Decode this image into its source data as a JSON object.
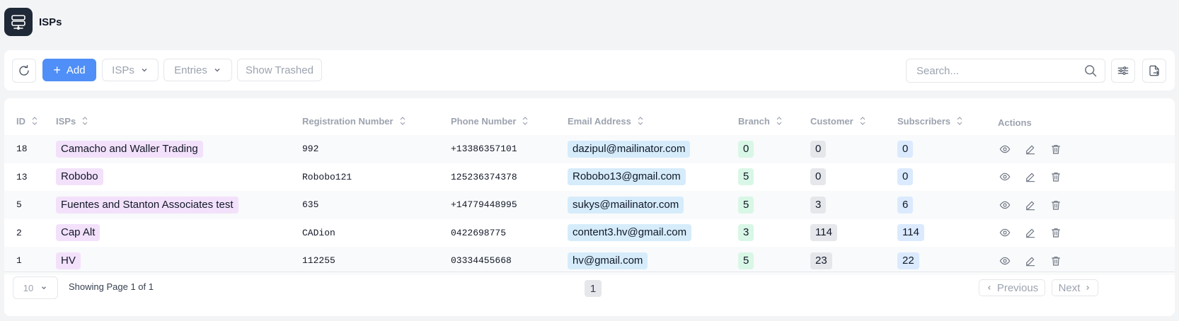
{
  "app": {
    "title": "ISPs"
  },
  "toolbar": {
    "add_label": "Add",
    "isps_dropdown": "ISPs",
    "entries_dropdown": "Entries",
    "show_trashed_label": "Show Trashed",
    "search_placeholder": "Search..."
  },
  "table": {
    "columns": [
      "ID",
      "ISPs",
      "Registration Number",
      "Phone Number",
      "Email Address",
      "Branch",
      "Customer",
      "Subscribers",
      "Actions"
    ],
    "rows": [
      {
        "id": "18",
        "isp": "Camacho and Waller Trading",
        "reg": "992",
        "phone": "+13386357101",
        "email": "dazipul@mailinator.com",
        "branch": "0",
        "customer": "0",
        "subscribers": "0"
      },
      {
        "id": "13",
        "isp": "Robobo",
        "reg": "Robobo121",
        "phone": "125236374378",
        "email": "Robobo13@gmail.com",
        "branch": "5",
        "customer": "0",
        "subscribers": "0"
      },
      {
        "id": "5",
        "isp": "Fuentes and Stanton Associates test",
        "reg": "635",
        "phone": "+14779448995",
        "email": "sukys@mailinator.com",
        "branch": "5",
        "customer": "3",
        "subscribers": "6"
      },
      {
        "id": "2",
        "isp": "Cap Alt",
        "reg": "CADion",
        "phone": "0422698775",
        "email": "content3.hv@gmail.com",
        "branch": "3",
        "customer": "114",
        "subscribers": "114"
      },
      {
        "id": "1",
        "isp": "HV",
        "reg": "112255",
        "phone": "03334455668",
        "email": "hv@gmail.com",
        "branch": "5",
        "customer": "23",
        "subscribers": "22"
      }
    ]
  },
  "pagination": {
    "page_size": "10",
    "info": "Showing Page 1 of 1",
    "current_page": "1",
    "previous_label": "Previous",
    "next_label": "Next"
  },
  "icons": {
    "logo": "server-icon",
    "refresh": "refresh-icon",
    "search": "search-icon",
    "filter": "sliders-icon",
    "export": "file-export-icon",
    "view": "eye-icon",
    "edit": "pencil-icon",
    "delete": "trash-icon"
  },
  "colors": {
    "accent": "#4f8ff7",
    "logo_bg": "#1f2937"
  }
}
